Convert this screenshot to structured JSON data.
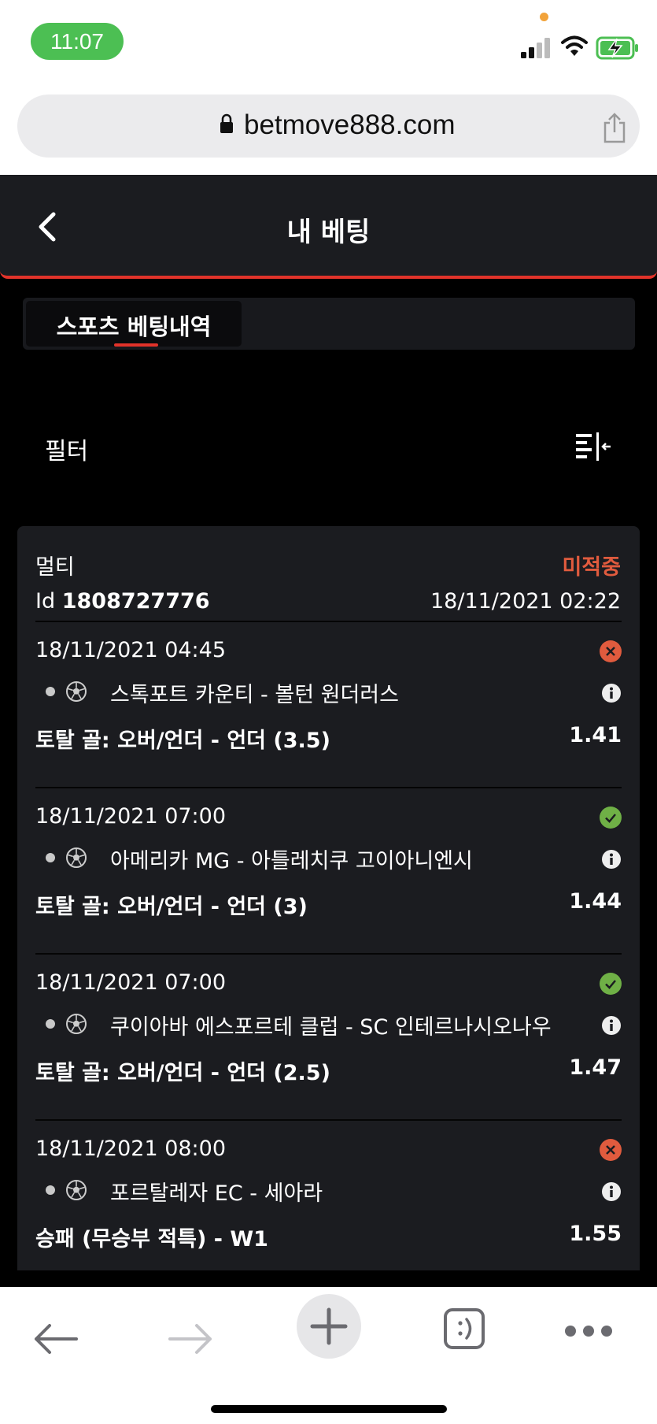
{
  "status_bar": {
    "time": "11:07",
    "icons": [
      "signal-icon",
      "wifi-icon",
      "battery-charging-icon"
    ]
  },
  "browser": {
    "url": "betmove888.com",
    "icons": [
      "lock-icon",
      "share-icon"
    ]
  },
  "header": {
    "title": "내 베팅",
    "back_icon": "chevron-left-icon",
    "accent_color": "#e2332a"
  },
  "tabs": [
    {
      "label": "스포츠 베팅내역",
      "active": true
    }
  ],
  "filter": {
    "label": "필터",
    "icon": "filter-sort-icon"
  },
  "bet": {
    "type": "멀티",
    "status": "미적중",
    "status_color": "#e05b3e",
    "id_prefix": "Id",
    "id": "1808727776",
    "placed": "18/11/2021 02:22",
    "selections": [
      {
        "time": "18/11/2021 04:45",
        "result": "lost",
        "match": "스톡포트 카운티 - 볼턴 원더러스",
        "market": "토탈 골: 오버/언더 - 언더 (3.5)",
        "odds": "1.41"
      },
      {
        "time": "18/11/2021 07:00",
        "result": "won",
        "match": "아메리카 MG - 아틀레치쿠 고이아니엔시",
        "market": "토탈 골: 오버/언더 - 언더 (3)",
        "odds": "1.44"
      },
      {
        "time": "18/11/2021 07:00",
        "result": "won",
        "match": "쿠이아바 에스포르테 클럽 - SC 인테르나시오나우",
        "market": "토탈 골: 오버/언더 - 언더 (2.5)",
        "odds": "1.47"
      },
      {
        "time": "18/11/2021 08:00",
        "result": "lost",
        "match": "포르탈레자 EC - 세아라",
        "market": "승패 (무승부 적특) - W1",
        "odds": "1.55"
      }
    ],
    "result_colors": {
      "won": "#6fb046",
      "lost": "#e05b3e"
    }
  },
  "toolbar": {
    "icons": [
      "back-arrow-icon",
      "forward-arrow-icon",
      "new-tab-plus-icon",
      "tabs-icon",
      "more-icon"
    ]
  }
}
